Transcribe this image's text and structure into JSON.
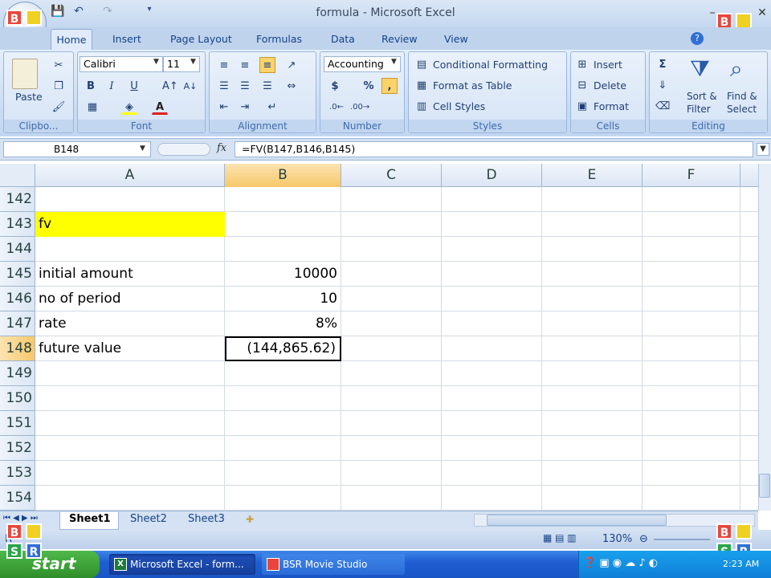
{
  "window": {
    "title": "formula - Microsoft Excel"
  },
  "logo": {
    "letters": [
      "B",
      "?",
      "S",
      "R"
    ],
    "colors": [
      "#e8463c",
      "#f0d020",
      "#2aa54a",
      "#2f6fd6"
    ]
  },
  "tabs": [
    "Home",
    "Insert",
    "Page Layout",
    "Formulas",
    "Data",
    "Review",
    "View"
  ],
  "ribbon": {
    "clipboard": {
      "paste": "Paste",
      "label": "Clipbo..."
    },
    "font": {
      "name": "Calibri",
      "size": "11",
      "bold": "B",
      "italic": "I",
      "underline": "U",
      "label": "Font"
    },
    "alignment": {
      "label": "Alignment"
    },
    "number": {
      "format": "Accounting",
      "currency": "$",
      "percent": "%",
      "label": "Number"
    },
    "styles": {
      "conditional": "Conditional Formatting",
      "table": "Format as Table",
      "cell_styles": "Cell Styles",
      "label": "Styles"
    },
    "cells": {
      "insert": "Insert",
      "delete": "Delete",
      "format": "Format",
      "label": "Cells"
    },
    "editing": {
      "sigma": "Σ",
      "sort": "Sort &",
      "sort2": "Filter",
      "find": "Find &",
      "find2": "Select",
      "label": "Editing"
    }
  },
  "formula_bar": {
    "name_box": "B148",
    "fx": "fx",
    "formula": "=FV(B147,B146,B145)"
  },
  "columns": [
    "A",
    "B",
    "C",
    "D",
    "E",
    "F"
  ],
  "rows": [
    {
      "num": "142",
      "a": "",
      "b": ""
    },
    {
      "num": "143",
      "a": "fv",
      "b": ""
    },
    {
      "num": "144",
      "a": "",
      "b": ""
    },
    {
      "num": "145",
      "a": "initial amount",
      "b": "10000"
    },
    {
      "num": "146",
      "a": "no of period",
      "b": "10"
    },
    {
      "num": "147",
      "a": "rate",
      "b": "8%"
    },
    {
      "num": "148",
      "a": "future value",
      "b": "(144,865.62)"
    },
    {
      "num": "149",
      "a": "",
      "b": ""
    },
    {
      "num": "150",
      "a": "",
      "b": ""
    },
    {
      "num": "151",
      "a": "",
      "b": ""
    },
    {
      "num": "152",
      "a": "",
      "b": ""
    },
    {
      "num": "153",
      "a": "",
      "b": ""
    },
    {
      "num": "154",
      "a": "",
      "b": ""
    }
  ],
  "sheets": [
    "Sheet1",
    "Sheet2",
    "Sheet3"
  ],
  "status": {
    "mode": "R",
    "zoom": "130%"
  },
  "taskbar": {
    "start": "start",
    "tasks": [
      "Microsoft Excel - form...",
      "BSR Movie Studio"
    ],
    "clock": "2:23 AM"
  },
  "colors": {
    "highlight": "#ffff00",
    "selected_col": "#f8d08a"
  }
}
